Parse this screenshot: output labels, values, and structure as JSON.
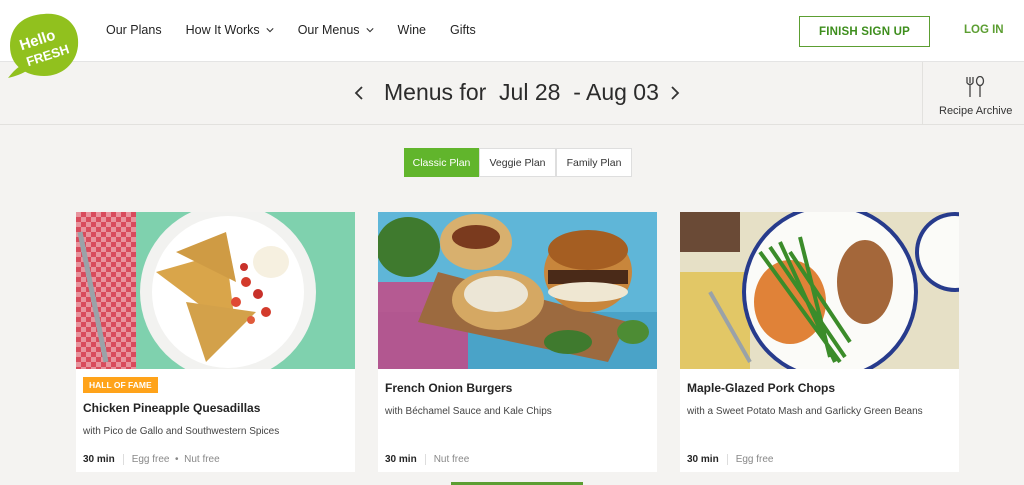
{
  "brand": {
    "logo_text_line1": "Hello",
    "logo_text_line2": "FRESH",
    "color": "#91c11e"
  },
  "nav": {
    "items": [
      {
        "label": "Our Plans",
        "dropdown": false
      },
      {
        "label": "How It Works",
        "dropdown": true
      },
      {
        "label": "Our Menus",
        "dropdown": true
      },
      {
        "label": "Wine",
        "dropdown": false
      },
      {
        "label": "Gifts",
        "dropdown": false
      }
    ],
    "finish_label": "FINISH SIGN UP",
    "login_label": "LOG IN"
  },
  "week": {
    "title": "Menus for  Jul 28  - Aug 03",
    "prev_icon": "chevron-left-icon",
    "next_icon": "chevron-right-icon",
    "archive_label": "Recipe Archive",
    "archive_icon": "fork-spoon-icon"
  },
  "plans": {
    "tabs": [
      {
        "label": "Classic Plan",
        "active": true
      },
      {
        "label": "Veggie Plan",
        "active": false
      },
      {
        "label": "Family Plan",
        "active": false
      }
    ]
  },
  "recipes": [
    {
      "badge": "HALL OF FAME",
      "title": "Chicken Pineapple Quesadillas",
      "subtitle": "with Pico de Gallo and Southwestern Spices",
      "time": "30 min",
      "tags": "Egg free  •  Nut free"
    },
    {
      "badge": "",
      "title": "French Onion Burgers",
      "subtitle": "with Béchamel Sauce and Kale Chips",
      "time": "30 min",
      "tags": "Nut free"
    },
    {
      "badge": "",
      "title": "Maple-Glazed Pork Chops",
      "subtitle": "with a Sweet Potato Mash and Garlicky Green Beans",
      "time": "30 min",
      "tags": "Egg free"
    }
  ],
  "colors": {
    "accent": "#61b52c",
    "badge": "#ffa31a",
    "background": "#f4f3f1"
  }
}
